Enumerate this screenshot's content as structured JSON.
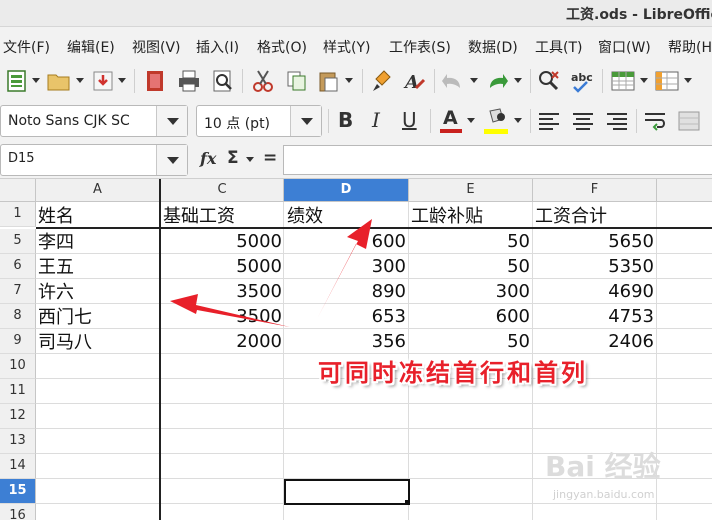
{
  "window": {
    "title": "工资.ods - LibreOffic"
  },
  "menu": [
    "文件(F)",
    "编辑(E)",
    "视图(V)",
    "插入(I)",
    "格式(O)",
    "样式(Y)",
    "工作表(S)",
    "数据(D)",
    "工具(T)",
    "窗口(W)",
    "帮助(H"
  ],
  "toolbar1": {
    "icons": [
      "new-icon",
      "open-icon",
      "save-icon",
      "export-pdf-icon",
      "print-icon",
      "print-preview-icon",
      "cut-icon",
      "copy-icon",
      "paste-icon",
      "clone-formatting-icon",
      "clear-formatting-icon",
      "undo-icon",
      "redo-icon",
      "find-replace-icon",
      "spelling-icon",
      "row-icon",
      "column-icon"
    ]
  },
  "toolbar2": {
    "font_name": "Noto Sans CJK SC",
    "font_size": "10 点 (pt)",
    "bold": "B",
    "italic": "I",
    "underline": "U",
    "font_color_letter": "A",
    "colors": {
      "font_color": "#c9211e",
      "highlight": "#ffff00",
      "accent": "#3d7fd4",
      "annotation": "#e8202a"
    }
  },
  "formula_bar": {
    "cell_ref": "D15",
    "fx": "fx",
    "sigma": "Σ",
    "equals": "=",
    "formula": ""
  },
  "sheet": {
    "corner": "",
    "columns": [
      "A",
      "C",
      "D",
      "E",
      "F"
    ],
    "active_column": "D",
    "rows": [
      "1",
      "5",
      "6",
      "7",
      "8",
      "9",
      "10",
      "11",
      "12",
      "13",
      "14",
      "15",
      "16"
    ],
    "active_row": "15",
    "header_row": [
      "姓名",
      "基础工资",
      "绩效",
      "工龄补贴",
      "工资合计"
    ],
    "data": [
      [
        "李四",
        "5000",
        "600",
        "50",
        "5650"
      ],
      [
        "王五",
        "5000",
        "300",
        "50",
        "5350"
      ],
      [
        "许六",
        "3500",
        "890",
        "300",
        "4690"
      ],
      [
        "西门七",
        "3500",
        "653",
        "600",
        "4753"
      ],
      [
        "司马八",
        "2000",
        "356",
        "50",
        "2406"
      ]
    ]
  },
  "annotation": "可同时冻结首行和首列",
  "watermark": {
    "main": "Bai 经验",
    "sub": "jingyan.baidu.com"
  }
}
